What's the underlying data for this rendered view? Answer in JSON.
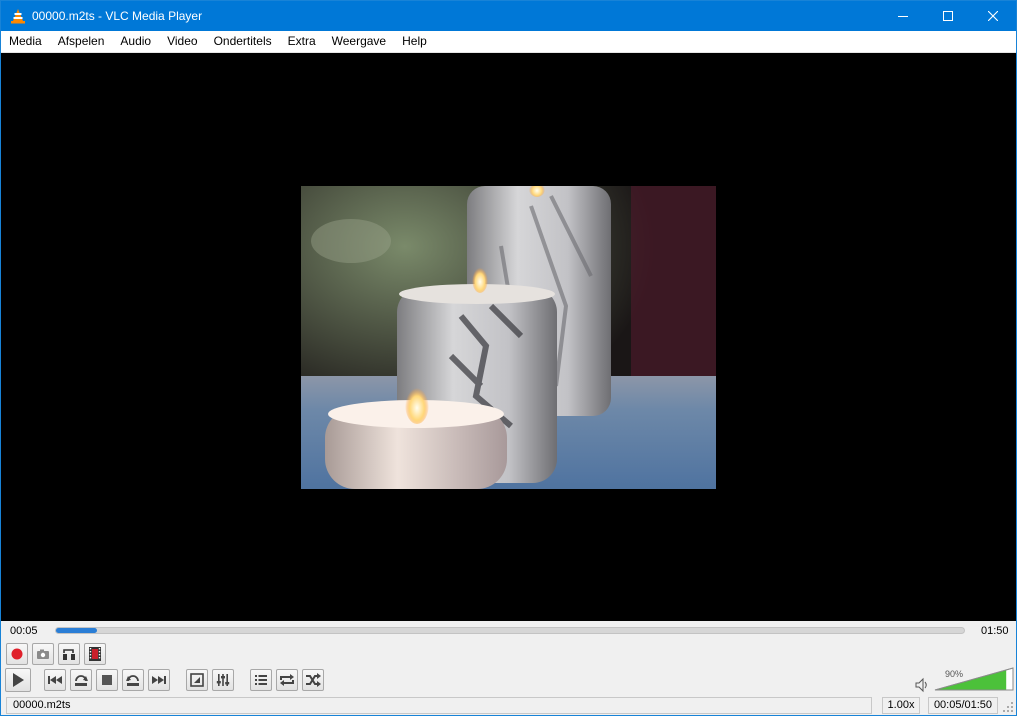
{
  "window": {
    "title": "00000.m2ts - VLC Media Player"
  },
  "menu": [
    "Media",
    "Afspelen",
    "Audio",
    "Video",
    "Ondertitels",
    "Extra",
    "Weergave",
    "Help"
  ],
  "seek": {
    "elapsed": "00:05",
    "total": "01:50",
    "progress": 0.045
  },
  "volume": {
    "label": "90%",
    "level": 0.9
  },
  "status": {
    "filename": "00000.m2ts",
    "speed": "1.00x",
    "time": "00:05/01:50"
  },
  "colors": {
    "titlebar": "#0078d7",
    "seek_fill": "#2a7ed6",
    "volume_fill": "#4cc13a",
    "record": "#e0202a"
  },
  "icons": {
    "title": "vlc-cone-icon",
    "row1": [
      "record-icon",
      "snapshot-icon",
      "loop-ab-icon",
      "frame-step-icon"
    ],
    "row2": [
      "play-icon",
      "previous-icon",
      "skip-back-icon",
      "stop-icon",
      "skip-forward-icon",
      "next-icon",
      "fullscreen-icon",
      "extended-settings-icon",
      "playlist-icon",
      "loop-icon",
      "shuffle-icon"
    ]
  }
}
